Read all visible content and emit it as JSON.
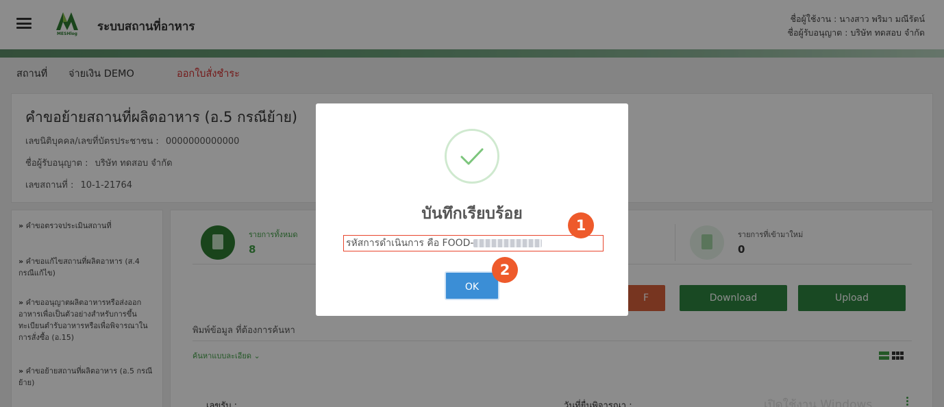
{
  "header": {
    "app_title": "ระบบสถานที่อาหาร",
    "logo_text": "MESHlog",
    "user_line": "ชื่อผู้ใช้งาน : นางสาว พริมา มณีรัตน์",
    "licensee_line": "ชื่อผู้รับอนุญาต : บริษัท ทดสอบ จำกัด"
  },
  "nav": {
    "items": [
      "สถานที่",
      "จ่ายเงิน DEMO",
      "ออกใบสั่งชำระ"
    ]
  },
  "info": {
    "title": "คำขอย้ายสถานที่ผลิตอาหาร (อ.5 กรณีย้าย)",
    "id_label": "เลขนิติบุคคล/เลขที่บัตรประชาชน :",
    "id_value": "0000000000000",
    "licensee_label": "ชื่อผู้รับอนุญาต :",
    "licensee_value": "บริษัท ทดสอบ จำกัด",
    "place_label": "เลขสถานที่ :",
    "place_value": "10-1-21764"
  },
  "sidebar": {
    "items": [
      "คำขอตรวจประเมินสถานที่",
      "คำขอแก้ไขสถานที่ผลิตอาหาร (ส.4 กรณีแก้ไข)",
      "คำขออนุญาตผลิตอาหารหรือส่งออกอาหารเพื่อเป็นตัวอย่างสำหรับการขึ้นทะเบียนตำรับอาหารหรือเพื่อพิจารณาในการสั่งซื้อ (อ.15)",
      "คำขอย้ายสถานที่ผลิตอาหาร (อ.5 กรณีย้าย)"
    ]
  },
  "stats": {
    "total_label": "รายการทั้งหมด",
    "total_value": "8",
    "new_label": "รายการที่เข้ามาใหม่",
    "new_value": "0"
  },
  "buttons": {
    "orange_partial": "F",
    "download": "Download",
    "upload": "Upload"
  },
  "search": {
    "label": "พิมพ์ข้อมูล ที่ต้องการค้นหา",
    "advanced_link": "ค้นหาแบบละเอียด ⌄"
  },
  "table": {
    "col_receipt": "เลขรับ :",
    "col_date": "วันที่ยื่นพิจารณา :",
    "watermark": "เปิดใช้งาน Windows"
  },
  "modal": {
    "title": "บันทึกเรียบร้อย",
    "text_prefix": "รหัสการดำเนินการ คือ FOOD-",
    "ok_label": "OK",
    "badge_1": "1",
    "badge_2": "2"
  },
  "colors": {
    "accent_green": "#2e7d32",
    "success_check": "#7cc57c",
    "ok_blue": "#3b8ed6",
    "badge_orange": "#ee5a2b",
    "highlight_border": "#e8452c",
    "nav_red": "#d32f2f"
  }
}
